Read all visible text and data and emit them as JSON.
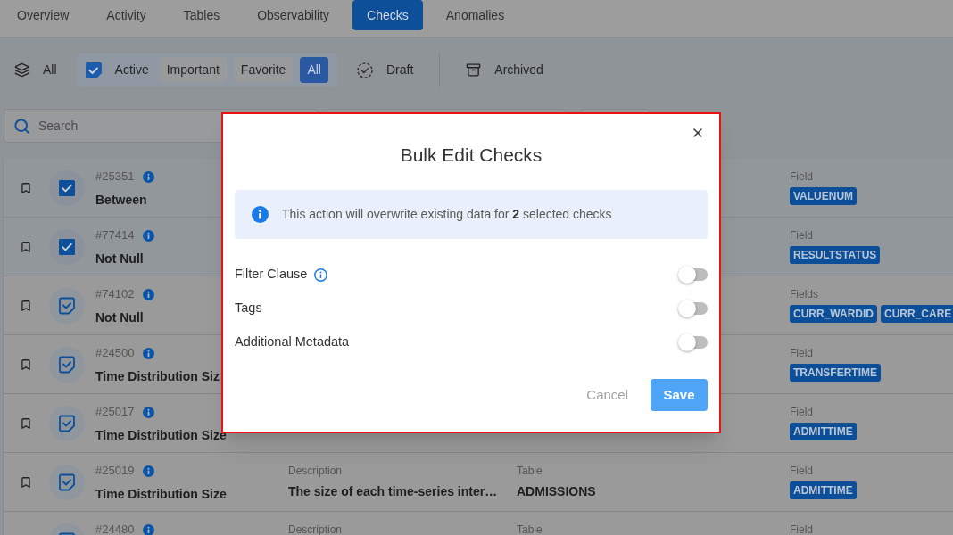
{
  "nav_tabs": [
    {
      "label": "Overview",
      "selected": false
    },
    {
      "label": "Activity",
      "selected": false
    },
    {
      "label": "Tables",
      "selected": false
    },
    {
      "label": "Observability",
      "selected": false
    },
    {
      "label": "Checks",
      "selected": true
    },
    {
      "label": "Anomalies",
      "selected": false
    }
  ],
  "status_filters": [
    {
      "kind": "layers",
      "label": "All",
      "selected": false
    },
    {
      "kind": "active",
      "label": "Active",
      "selected": true,
      "sub_filters": [
        {
          "label": "Important",
          "selected": false
        },
        {
          "label": "Favorite",
          "selected": false
        },
        {
          "label": "All",
          "selected": true
        }
      ]
    },
    {
      "kind": "draft",
      "label": "Draft",
      "selected": false
    },
    {
      "kind": "archive",
      "label": "Archived",
      "selected": false
    }
  ],
  "search": {
    "placeholder": "Search"
  },
  "checks": [
    {
      "id": "#25351",
      "name": "Between",
      "selected": true,
      "field_label": "Field",
      "fields": [
        "VALUENUM"
      ]
    },
    {
      "id": "#77414",
      "name": "Not Null",
      "selected": true,
      "field_label": "Field",
      "fields": [
        "RESULTSTATUS"
      ]
    },
    {
      "id": "#74102",
      "name": "Not Null",
      "selected": false,
      "field_label": "Fields",
      "fields": [
        "CURR_WARDID",
        "CURR_CARE"
      ]
    },
    {
      "id": "#24500",
      "name": "Time Distribution Siz",
      "selected": false,
      "field_label": "Field",
      "fields": [
        "TRANSFERTIME"
      ]
    },
    {
      "id": "#25017",
      "name": "Time Distribution Size",
      "selected": false,
      "field_label": "Field",
      "fields": [
        "ADMITTIME"
      ]
    },
    {
      "id": "#25019",
      "name": "Time Distribution Size",
      "selected": false,
      "description_label": "Description",
      "description": "The size of each time-series inter…",
      "table_label": "Table",
      "table": "ADMISSIONS",
      "field_label": "Field",
      "fields": [
        "ADMITTIME"
      ]
    },
    {
      "id": "#24480",
      "selected": false,
      "description_label": "Description",
      "table_label": "Table",
      "field_label": "Field"
    }
  ],
  "dialog": {
    "title": "Bulk Edit Checks",
    "notice": "This action will overwrite existing data for **2** selected checks",
    "options": [
      {
        "label": "Filter Clause",
        "info": true,
        "on": false
      },
      {
        "label": "Tags",
        "info": false,
        "on": false
      },
      {
        "label": "Additional Metadata",
        "info": false,
        "on": false
      }
    ],
    "cancel": "Cancel",
    "save": "Save"
  }
}
